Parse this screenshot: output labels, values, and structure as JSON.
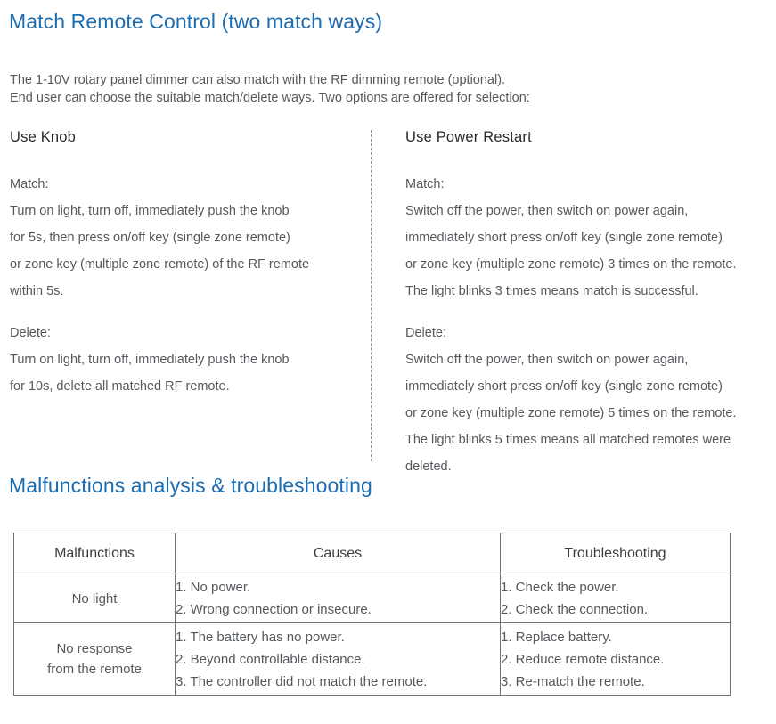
{
  "headings": {
    "match_remote_control": "Match Remote Control (two match ways)",
    "malfunctions": "Malfunctions analysis & troubleshooting"
  },
  "intro": {
    "line1": "The 1-10V rotary panel dimmer can also match with the RF dimming remote (optional).",
    "line2": "End user can choose the suitable match/delete ways. Two options are offered for selection:"
  },
  "columns": {
    "left": {
      "title": "Use Knob",
      "match": {
        "label": "Match:",
        "lines": [
          "Turn on light, turn off, immediately push the knob",
          "for 5s, then press on/off key (single zone remote)",
          "or zone key (multiple zone remote) of the RF remote",
          "within 5s."
        ]
      },
      "delete": {
        "label": "Delete:",
        "lines": [
          "Turn on light, turn off, immediately push the knob",
          "for 10s, delete all matched RF remote."
        ]
      }
    },
    "right": {
      "title": "Use Power Restart",
      "match": {
        "label": "Match:",
        "lines": [
          "Switch off the power, then switch on power again,",
          "immediately short press on/off key (single zone remote)",
          "or zone key (multiple zone remote) 3 times on the remote.",
          "The light blinks 3 times means match is successful."
        ]
      },
      "delete": {
        "label": "Delete:",
        "lines": [
          "Switch off the power, then switch on power again,",
          "immediately short press on/off key (single zone remote)",
          "or zone key (multiple zone remote) 5 times on the remote.",
          "The light blinks 5 times means all matched remotes were",
          "deleted."
        ]
      }
    }
  },
  "table": {
    "headers": [
      "Malfunctions",
      "Causes",
      "Troubleshooting"
    ],
    "rows": [
      {
        "malfunction_lines": [
          "No light"
        ],
        "causes": [
          "1. No power.",
          "2. Wrong connection or insecure."
        ],
        "troubleshooting": [
          "1. Check the power.",
          "2. Check the connection."
        ]
      },
      {
        "malfunction_lines": [
          "No response",
          "from the remote"
        ],
        "causes": [
          "1. The battery has no power.",
          "2. Beyond controllable distance.",
          "3. The controller did not match the remote."
        ],
        "troubleshooting": [
          "1. Replace battery.",
          "2. Reduce remote distance.",
          "3. Re-match the remote."
        ]
      }
    ]
  },
  "colors": {
    "heading_blue": "#1c6cb0",
    "body_gray": "#55595d",
    "title_dark": "#262a2d",
    "table_border": "#6f7377"
  }
}
